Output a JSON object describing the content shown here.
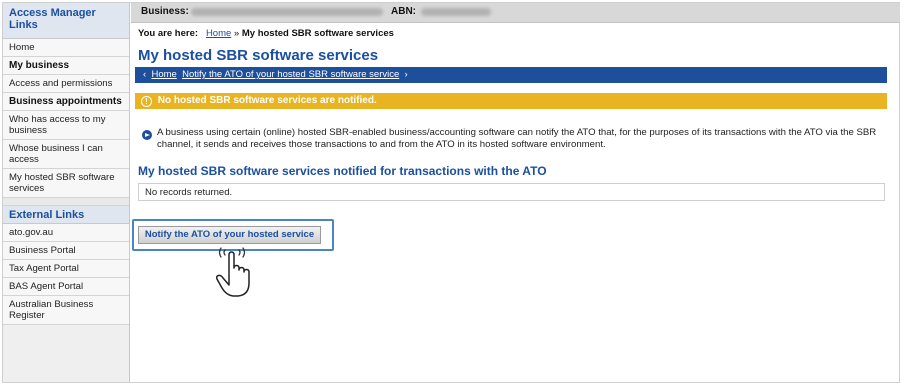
{
  "topbar": {
    "business_label": "Business:",
    "abn_label": "ABN:"
  },
  "sidebar": {
    "access_manager_heading": "Access Manager Links",
    "items": [
      {
        "label": "Home",
        "bold": false
      },
      {
        "label": "My business",
        "bold": true
      },
      {
        "label": "Access and permissions",
        "bold": false
      },
      {
        "label": "Business appointments",
        "bold": true
      },
      {
        "label": "Who has access to my business",
        "bold": false
      },
      {
        "label": "Whose business I can access",
        "bold": false
      },
      {
        "label": "My hosted SBR software services",
        "bold": false
      }
    ],
    "external_heading": "External Links",
    "external_items": [
      {
        "label": "ato.gov.au"
      },
      {
        "label": "Business Portal"
      },
      {
        "label": "Tax Agent Portal"
      },
      {
        "label": "BAS Agent Portal"
      },
      {
        "label": "Australian Business Register"
      }
    ]
  },
  "breadcrumb": {
    "prefix": "You are here:",
    "home": "Home",
    "separator": "»",
    "current": "My hosted SBR software services"
  },
  "page_title": "My hosted SBR software services",
  "nav_bar": {
    "back_glyph": "‹",
    "home_link": "Home",
    "action_link": "Notify the ATO of your hosted SBR software service",
    "forward_glyph": "›"
  },
  "warning": {
    "icon": "!",
    "text": "No hosted SBR software services are notified."
  },
  "info_text": "A business using certain (online) hosted SBR-enabled business/accounting software can notify the ATO that, for the purposes of its transactions with the ATO via the SBR channel, it sends and receives those transactions to and from the ATO in its hosted software environment.",
  "section_title": "My hosted SBR software services notified for transactions with the ATO",
  "records_text": "No records returned.",
  "notify_button_label": "Notify the ATO of your hosted service",
  "colors": {
    "brand_blue": "#1d4f9a",
    "warning_yellow": "#e9b422",
    "highlight_blue": "#4a84c4"
  }
}
